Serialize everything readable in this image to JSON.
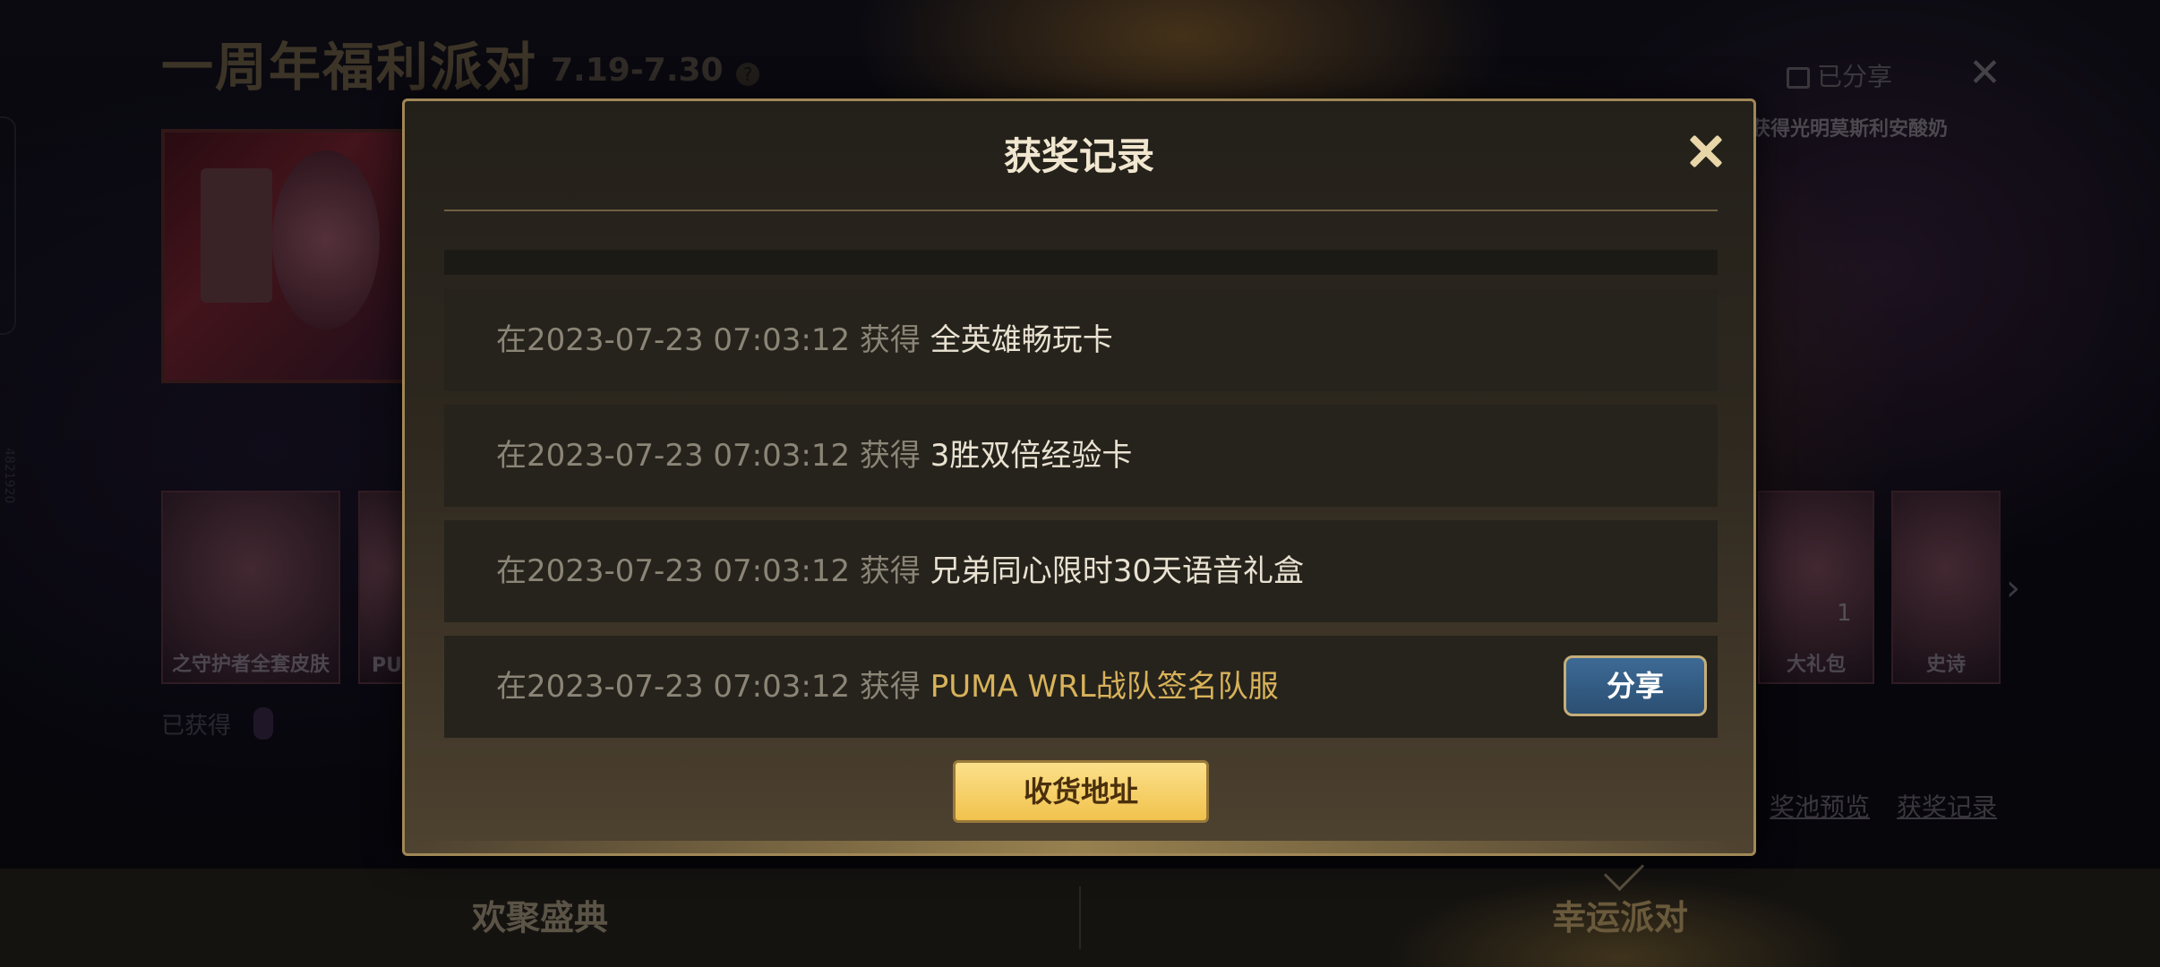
{
  "background_page": {
    "title": "一周年福利派对",
    "dates": "7.19-7.30",
    "share_status": "已分享",
    "marquee": "获得光明莫斯利安酸奶",
    "cards": [
      {
        "label": "之守护者全套皮肤"
      },
      {
        "label": "PU"
      },
      {
        "label": "大礼包"
      },
      {
        "label": "史诗"
      }
    ],
    "owned_label": "已获得",
    "links": {
      "pool_preview": "奖池预览",
      "prize_record": "获奖记录"
    },
    "side_id": "4821920",
    "card_badge": "1"
  },
  "bottom_nav": {
    "left": "欢聚盛典",
    "right": "幸运派对"
  },
  "modal": {
    "title": "获奖记录",
    "records": [
      {
        "meta": "在2023-07-23 07:03:12 获得 ",
        "prize": "全英雄畅玩卡"
      },
      {
        "meta": "在2023-07-23 07:03:12 获得 ",
        "prize": "3胜双倍经验卡"
      },
      {
        "meta": "在2023-07-23 07:03:12 获得 ",
        "prize": "兄弟同心限时30天语音礼盒"
      },
      {
        "meta": "在2023-07-23 07:03:12 获得 ",
        "prize": "PUMA WRL战队签名队服",
        "button": "分享"
      }
    ],
    "address_button": "收货地址"
  },
  "colors": {
    "gold_text": "#d8b25a",
    "share_button": "#2b4f73",
    "address_button": "#f1c24d",
    "modal_border": "#a08756"
  }
}
